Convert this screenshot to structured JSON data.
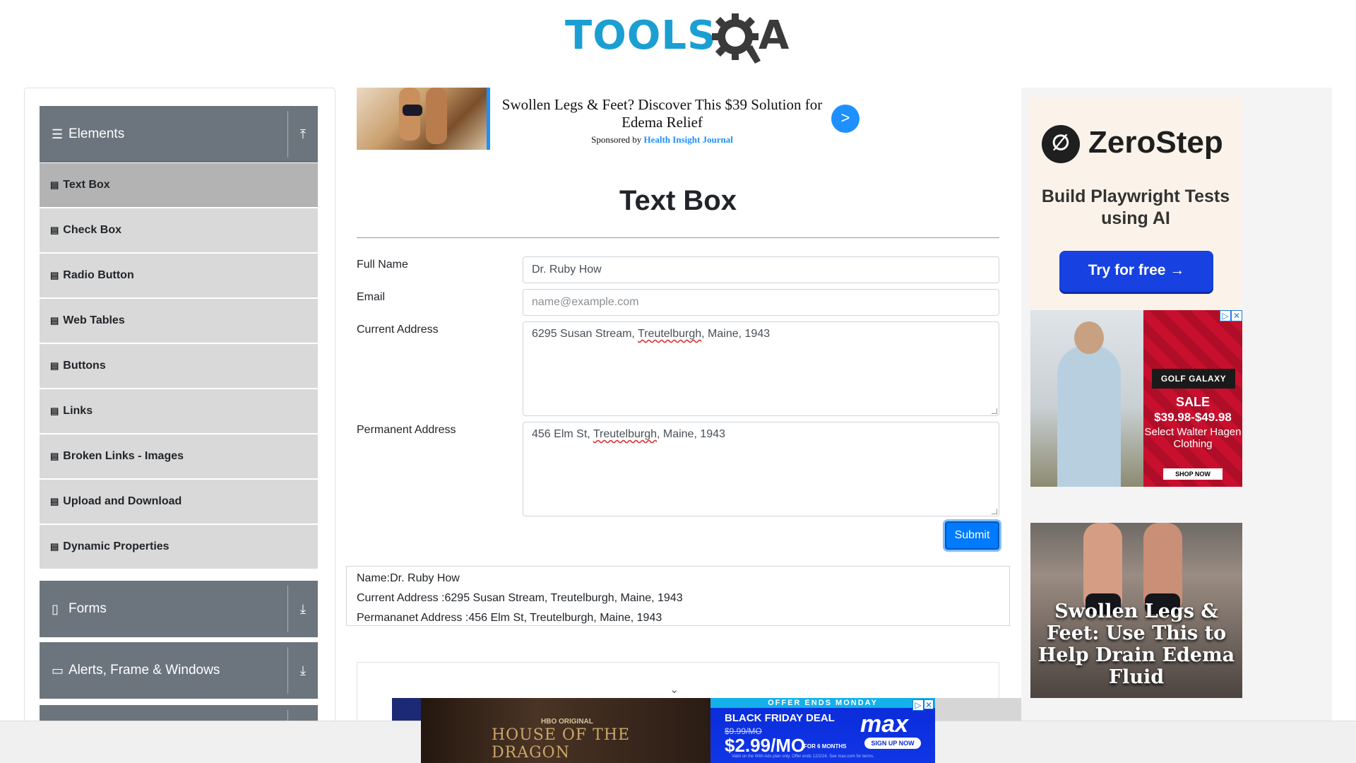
{
  "header": {
    "logo_text_blue": "TOOLS",
    "logo_text_dark": "A"
  },
  "sidebar": {
    "elements_group": {
      "label": "Elements",
      "icon": "hamburger-icon",
      "toggle_icon": "collapse-up-icon"
    },
    "items": [
      {
        "label": "Text Box",
        "active": true
      },
      {
        "label": "Check Box"
      },
      {
        "label": "Radio Button"
      },
      {
        "label": "Web Tables"
      },
      {
        "label": "Buttons"
      },
      {
        "label": "Links"
      },
      {
        "label": "Broken Links - Images"
      },
      {
        "label": "Upload and Download"
      },
      {
        "label": "Dynamic Properties"
      }
    ],
    "forms_group": {
      "label": "Forms",
      "icon": "form-icon",
      "toggle_icon": "download-icon"
    },
    "alerts_group": {
      "label": "Alerts, Frame & Windows",
      "icon": "window-icon",
      "toggle_icon": "download-icon"
    }
  },
  "top_ad": {
    "title": "Swollen Legs & Feet? Discover This $39 Solution for Edema Relief",
    "sponsor_prefix": "Sponsored by",
    "sponsor_name": "Health Insight Journal",
    "arrow": ">",
    "accent_color": "#1e90ff"
  },
  "main": {
    "title": "Text Box",
    "full_name_label": "Full Name",
    "full_name_value": "Dr. Ruby How",
    "email_label": "Email",
    "email_placeholder": "name@example.com",
    "current_address_label": "Current Address",
    "current_address_pre": "6295 Susan Stream, ",
    "current_address_city": "Treutelburgh",
    "current_address_post": ", Maine, 1943",
    "permanent_address_label": "Permanent Address",
    "permanent_address_pre": "456 Elm St, ",
    "permanent_address_city": "Treutelburgh",
    "permanent_address_post": ", Maine, 1943",
    "submit_label": "Submit"
  },
  "output": {
    "name_line": "Name:Dr. Ruby How",
    "current_line": "Current Address :6295 Susan Stream, Treutelburgh, Maine, 1943",
    "permanent_line": "Permananet Address :456 Elm St, Treutelburgh, Maine, 1943"
  },
  "right_ads": {
    "zerostep": {
      "brand": "ZeroStep",
      "headline": "Build Playwright Tests using AI",
      "cta": "Try for free →"
    },
    "golf": {
      "brand": "GOLF GALAXY",
      "sale": "SALE",
      "price": "$39.98-$49.98",
      "desc": "Select Walter Hagen Clothing",
      "cta": "SHOP NOW"
    },
    "swollen": {
      "headline": "Swollen Legs & Feet: Use This to Help Drain Edema Fluid"
    }
  },
  "bottom_ad": {
    "original_label": "HBO ORIGINAL",
    "show_title": "HOUSE OF THE DRAGON",
    "offer_banner": "OFFER ENDS MONDAY",
    "deal": "BLACK FRIDAY DEAL",
    "old_price": "$9.99/MO",
    "price": "$2.99/MO",
    "price_suffix": "FOR 6 MONTHS",
    "logo": "max",
    "cta": "SIGN UP NOW",
    "fine_print": "Valid on the With Ads plan only. Offer ends 12/2/24. See max.com for terms."
  }
}
